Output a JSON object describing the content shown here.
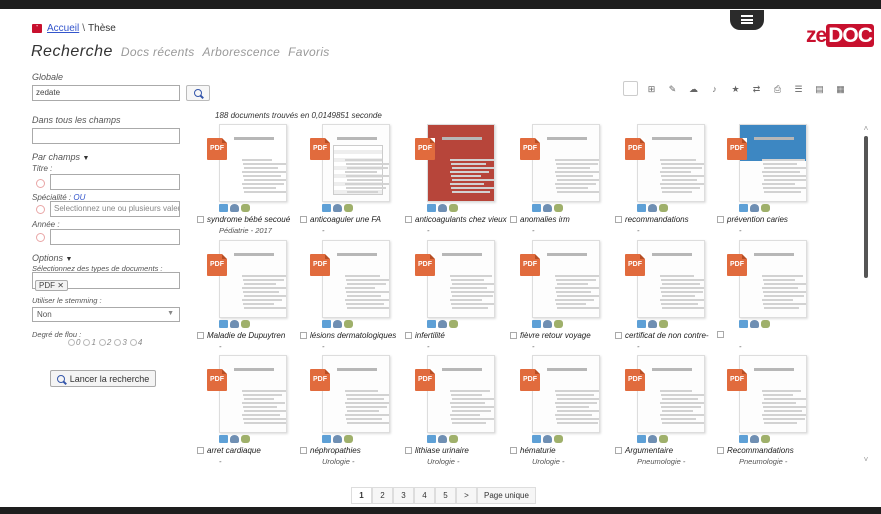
{
  "header": {
    "breadcrumb": {
      "home_icon": "home-icon",
      "home_label": "Accueil",
      "separator": "\\",
      "current": "Thèse"
    },
    "logo": {
      "part1": "ze",
      "part2": "DOC",
      "color": "#c8102e"
    }
  },
  "tabs": [
    {
      "label": "Recherche",
      "active": true
    },
    {
      "label": "Docs récents",
      "active": false
    },
    {
      "label": "Arborescence",
      "active": false
    },
    {
      "label": "Favoris",
      "active": false
    }
  ],
  "search": {
    "global_label": "Globale",
    "global_value": "zedate",
    "all_fields_label": "Dans tous les champs",
    "all_fields_value": "",
    "by_fields_label": "Par champs",
    "title_label": "Titre :",
    "specialty_label": "Spécialité :",
    "specialty_or": "OU",
    "specialty_placeholder": "Selectionnez une ou plusieurs valeurs",
    "year_label": "Année :",
    "options_label": "Options",
    "doctypes_label": "Sélectionnez des types de documents :",
    "doctype_tag": "PDF ✕",
    "stemming_label": "Utiliser le stemming :",
    "stemming_value": "Non",
    "fuzzy_label": "Degré de flou :",
    "fuzzy_options": [
      "0",
      "1",
      "2",
      "3",
      "4"
    ],
    "launch_label": "Lancer la recherche"
  },
  "results": {
    "count_text": "188 documents trouvés en 0,0149851 seconde",
    "items": [
      {
        "title": "syndrome bébé secoué",
        "sub": "Pédiatrie - 2017",
        "thumb": "red"
      },
      {
        "title": "anticoaguler une FA",
        "sub": "-",
        "thumb": "grid"
      },
      {
        "title": "anticoagulants chez vieux",
        "sub": "-",
        "thumb": "maroon"
      },
      {
        "title": "anomalies irm",
        "sub": "-",
        "thumb": "text"
      },
      {
        "title": "recommandations",
        "sub": "-",
        "thumb": "text"
      },
      {
        "title": "prévention caries",
        "sub": "-",
        "thumb": "blue"
      },
      {
        "title": "Maladie de Dupuytren",
        "sub": "-",
        "thumb": "text"
      },
      {
        "title": "lésions dermatologiques",
        "sub": "-",
        "thumb": "text"
      },
      {
        "title": "infertilité",
        "sub": "-",
        "thumb": "text"
      },
      {
        "title": "fièvre retour voyage",
        "sub": "-",
        "thumb": "text"
      },
      {
        "title": "certificat de non contre-",
        "sub": "-",
        "thumb": "text"
      },
      {
        "title": "",
        "sub": "-",
        "thumb": "text"
      },
      {
        "title": "arret cardiaque",
        "sub": "-",
        "thumb": "text"
      },
      {
        "title": "néphropathies",
        "sub": "Urologie -",
        "thumb": "text"
      },
      {
        "title": "lithiase urinaire",
        "sub": "Urologie -",
        "thumb": "text"
      },
      {
        "title": "hématurie",
        "sub": "Urologie -",
        "thumb": "text"
      },
      {
        "title": "Argumentaire",
        "sub": "Pneumologie -",
        "thumb": "text"
      },
      {
        "title": "Recommandations",
        "sub": "Pneumologie -",
        "thumb": "text"
      }
    ]
  },
  "toolbar_icons": [
    "checkbox-icon",
    "basket-icon",
    "edit-icon",
    "cloud-icon",
    "bell-icon",
    "star-icon",
    "transfer-icon",
    "print-icon",
    "list-icon",
    "card-icon",
    "grid-icon"
  ],
  "pagination": {
    "pages": [
      "1",
      "2",
      "3",
      "4",
      "5",
      ">"
    ],
    "single_page": "Page unique"
  },
  "colors": {
    "pdf_badge": "#e16b3d",
    "link": "#3355cc",
    "brand": "#c8102e"
  }
}
